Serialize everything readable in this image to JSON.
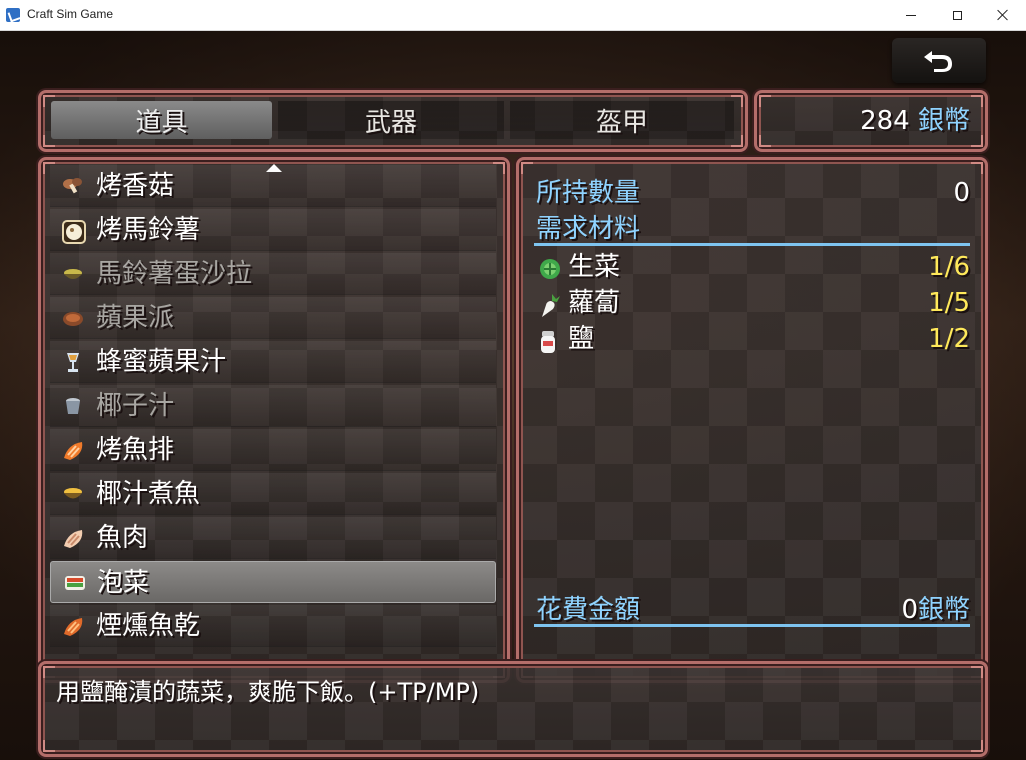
{
  "window": {
    "title": "Craft Sim Game"
  },
  "tabs": [
    {
      "label": "道具",
      "selected": true
    },
    {
      "label": "武器",
      "selected": false
    },
    {
      "label": "盔甲",
      "selected": false
    }
  ],
  "currency": {
    "amount": "284",
    "unit": "銀幣"
  },
  "items": [
    {
      "label": "烤香菇",
      "icon": "mushroom-icon",
      "enabled": true
    },
    {
      "label": "烤馬鈴薯",
      "icon": "potato-icon",
      "enabled": true
    },
    {
      "label": "馬鈴薯蛋沙拉",
      "icon": "salad-bowl-icon",
      "enabled": false
    },
    {
      "label": "蘋果派",
      "icon": "pie-icon",
      "enabled": false
    },
    {
      "label": "蜂蜜蘋果汁",
      "icon": "juice-glass-icon",
      "enabled": true
    },
    {
      "label": "椰子汁",
      "icon": "coconut-cup-icon",
      "enabled": false
    },
    {
      "label": "烤魚排",
      "icon": "fish-fillet-icon",
      "enabled": true
    },
    {
      "label": "椰汁煮魚",
      "icon": "stew-bowl-icon",
      "enabled": true
    },
    {
      "label": "魚肉",
      "icon": "fish-meat-icon",
      "enabled": true
    },
    {
      "label": "泡菜",
      "icon": "kimchi-icon",
      "enabled": true,
      "selected": true
    },
    {
      "label": "煙燻魚乾",
      "icon": "smoked-fish-icon",
      "enabled": true
    }
  ],
  "details": {
    "owned_label": "所持數量",
    "owned_value": "0",
    "materials_header": "需求材料",
    "materials": [
      {
        "label": "生菜",
        "count": "1/6",
        "icon": "lettuce-icon"
      },
      {
        "label": "蘿蔔",
        "count": "1/5",
        "icon": "radish-icon"
      },
      {
        "label": "鹽",
        "count": "1/2",
        "icon": "salt-icon"
      }
    ],
    "cost_label": "花費金額",
    "cost_value": "0",
    "cost_unit": "銀幣"
  },
  "description": "用鹽醃漬的蔬菜，爽脆下飯。(+TP/MP)",
  "colors": {
    "frame": "#b46e6a",
    "highlight_blue": "#8fd3ff",
    "count_yellow": "#ffe95a"
  }
}
